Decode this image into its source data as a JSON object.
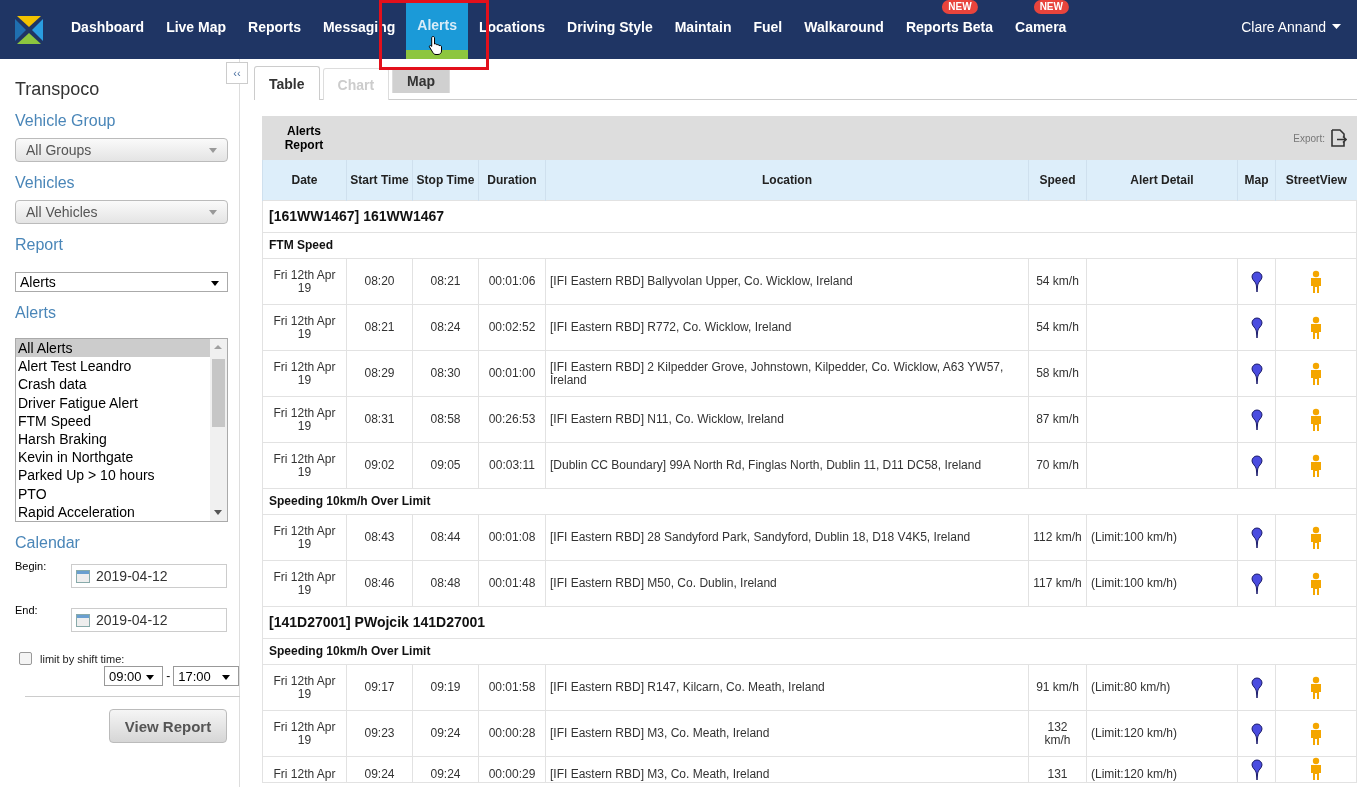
{
  "nav": {
    "items": [
      {
        "label": "Dashboard",
        "selected": false
      },
      {
        "label": "Live Map",
        "selected": false
      },
      {
        "label": "Reports",
        "selected": false
      },
      {
        "label": "Messaging",
        "selected": false
      },
      {
        "label": "Alerts",
        "selected": true
      },
      {
        "label": "Locations",
        "selected": false
      },
      {
        "label": "Driving Style",
        "selected": false
      },
      {
        "label": "Maintain",
        "selected": false
      },
      {
        "label": "Fuel",
        "selected": false
      },
      {
        "label": "Walkaround",
        "selected": false
      },
      {
        "label": "Reports Beta",
        "selected": false,
        "badge": "NEW"
      },
      {
        "label": "Camera",
        "selected": false,
        "badge": "NEW"
      }
    ],
    "user": "Clare Annand"
  },
  "sidebar": {
    "collapse": "‹‹",
    "title": "Transpoco",
    "vehicle_group": {
      "label": "Vehicle Group",
      "value": "All Groups"
    },
    "vehicles": {
      "label": "Vehicles",
      "value": "All Vehicles"
    },
    "report": {
      "label": "Report",
      "value": "Alerts"
    },
    "alerts": {
      "label": "Alerts",
      "items": [
        {
          "label": "All Alerts",
          "selected": true
        },
        {
          "label": "Alert Test Leandro",
          "selected": false
        },
        {
          "label": "Crash data",
          "selected": false
        },
        {
          "label": "Driver Fatigue Alert",
          "selected": false
        },
        {
          "label": "FTM Speed",
          "selected": false
        },
        {
          "label": "Harsh Braking",
          "selected": false
        },
        {
          "label": "Kevin in Northgate",
          "selected": false
        },
        {
          "label": "Parked Up > 10 hours",
          "selected": false
        },
        {
          "label": "PTO",
          "selected": false
        },
        {
          "label": "Rapid Acceleration",
          "selected": false
        }
      ]
    },
    "calendar": {
      "label": "Calendar",
      "begin_label": "Begin:",
      "begin": "2019-04-12",
      "end_label": "End:",
      "end": "2019-04-12"
    },
    "shift": {
      "label": "limit by shift time:",
      "checked": false,
      "from": "09:00",
      "separator": "-",
      "to": "17:00"
    },
    "button": "View Report"
  },
  "tabs": [
    {
      "label": "Table",
      "selected": true,
      "disabled": false
    },
    {
      "label": "Chart",
      "selected": false,
      "disabled": true
    },
    {
      "label": "Map",
      "selected": false,
      "disabled": false
    }
  ],
  "report": {
    "title": "Alerts Report",
    "export": "Export:",
    "columns": [
      "Date",
      "Start Time",
      "Stop Time",
      "Duration",
      "Location",
      "Speed",
      "Alert Detail",
      "Map",
      "StreetView"
    ],
    "rows": [
      {
        "kind": "vehicle",
        "text": "[161WW1467] 161WW1467"
      },
      {
        "kind": "alert_type",
        "text": "FTM Speed"
      },
      {
        "kind": "data",
        "cells": [
          "Fri 12th Apr 19",
          "08:20",
          "08:21",
          "00:01:06",
          "[IFI Eastern RBD] Ballyvolan Upper, Co. Wicklow, Ireland",
          "54 km/h",
          ""
        ]
      },
      {
        "kind": "data",
        "cells": [
          "Fri 12th Apr 19",
          "08:21",
          "08:24",
          "00:02:52",
          "[IFI Eastern RBD] R772, Co. Wicklow, Ireland",
          "54 km/h",
          ""
        ]
      },
      {
        "kind": "data",
        "cells": [
          "Fri 12th Apr 19",
          "08:29",
          "08:30",
          "00:01:00",
          "[IFI Eastern RBD] 2 Kilpedder Grove, Johnstown, Kilpedder, Co. Wicklow, A63 YW57, Ireland",
          "58 km/h",
          ""
        ]
      },
      {
        "kind": "data",
        "cells": [
          "Fri 12th Apr 19",
          "08:31",
          "08:58",
          "00:26:53",
          "[IFI Eastern RBD] N11, Co. Wicklow, Ireland",
          "87 km/h",
          ""
        ]
      },
      {
        "kind": "data",
        "cells": [
          "Fri 12th Apr 19",
          "09:02",
          "09:05",
          "00:03:11",
          "[Dublin CC Boundary] 99A North Rd, Finglas North, Dublin 11, D11 DC58, Ireland",
          "70 km/h",
          ""
        ]
      },
      {
        "kind": "alert_type",
        "text": "Speeding 10km/h Over Limit"
      },
      {
        "kind": "data",
        "cells": [
          "Fri 12th Apr 19",
          "08:43",
          "08:44",
          "00:01:08",
          "[IFI Eastern RBD] 28 Sandyford Park, Sandyford, Dublin 18, D18 V4K5, Ireland",
          "112 km/h",
          "(Limit:100 km/h)"
        ]
      },
      {
        "kind": "data",
        "cells": [
          "Fri 12th Apr 19",
          "08:46",
          "08:48",
          "00:01:48",
          "[IFI Eastern RBD] M50, Co. Dublin, Ireland",
          "117 km/h",
          "(Limit:100 km/h)"
        ]
      },
      {
        "kind": "vehicle",
        "text": "[141D27001] PWojcik 141D27001"
      },
      {
        "kind": "alert_type",
        "text": "Speeding 10km/h Over Limit"
      },
      {
        "kind": "data",
        "cells": [
          "Fri 12th Apr 19",
          "09:17",
          "09:19",
          "00:01:58",
          "[IFI Eastern RBD] R147, Kilcarn, Co. Meath, Ireland",
          "91 km/h",
          "(Limit:80 km/h)"
        ]
      },
      {
        "kind": "data",
        "cells": [
          "Fri 12th Apr 19",
          "09:23",
          "09:24",
          "00:00:28",
          "[IFI Eastern RBD] M3, Co. Meath, Ireland",
          "132 km/h",
          "(Limit:120 km/h)"
        ]
      },
      {
        "kind": "cut",
        "cells": [
          "Fri 12th Apr",
          "09:24",
          "09:24",
          "00:00:29",
          "[IFI Eastern RBD] M3, Co. Meath, Ireland",
          "131",
          "(Limit:120 km/h)"
        ]
      }
    ]
  }
}
